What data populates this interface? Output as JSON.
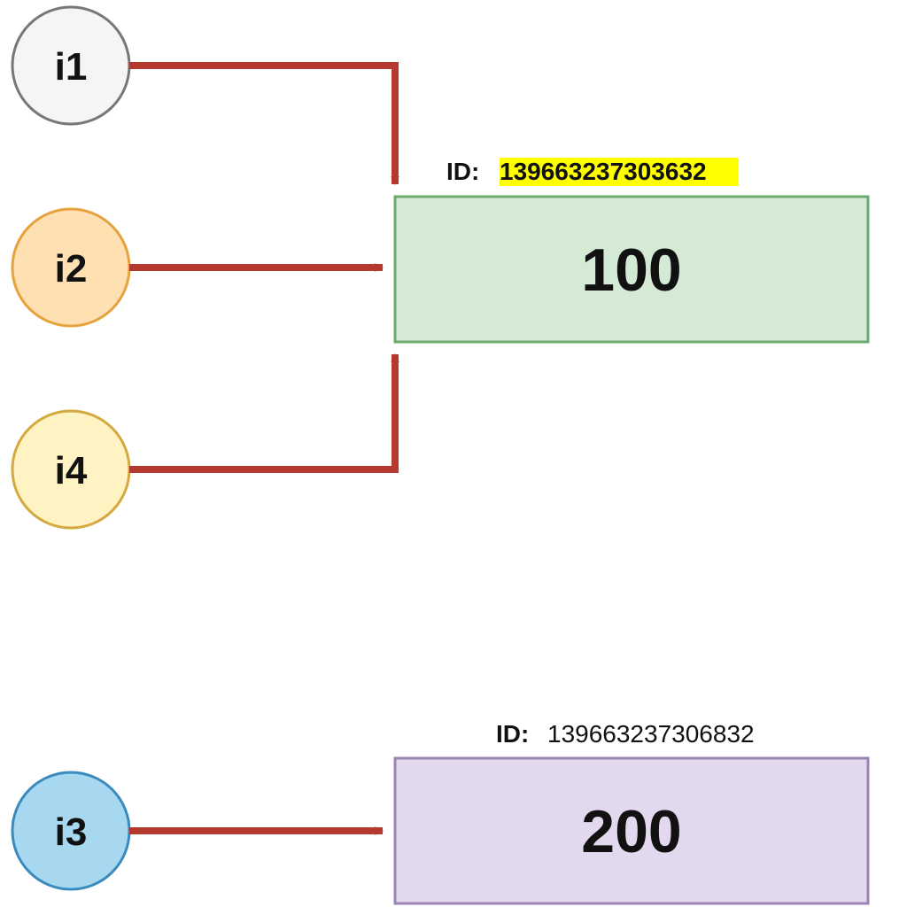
{
  "nodes": {
    "i1": {
      "label": "i1",
      "fill": "#f5f5f5",
      "stroke": "#777777"
    },
    "i2": {
      "label": "i2",
      "fill": "#ffe0b2",
      "stroke": "#e6a23c"
    },
    "i4": {
      "label": "i4",
      "fill": "#fff3c4",
      "stroke": "#d4a93f"
    },
    "i3": {
      "label": "i3",
      "fill": "#a7d8f0",
      "stroke": "#3a8bbd"
    }
  },
  "objects": {
    "obj1": {
      "id_prefix": "ID",
      "id_value": "139663237303632",
      "value": "100",
      "fill": "#d5ead5",
      "stroke": "#6fa96f",
      "highlight": true
    },
    "obj2": {
      "id_prefix": "ID",
      "id_value": "139663237306832",
      "value": "200",
      "fill": "#e3d9ee",
      "stroke": "#9885b3",
      "highlight": false
    }
  },
  "arrow_color": "#b43a2f"
}
